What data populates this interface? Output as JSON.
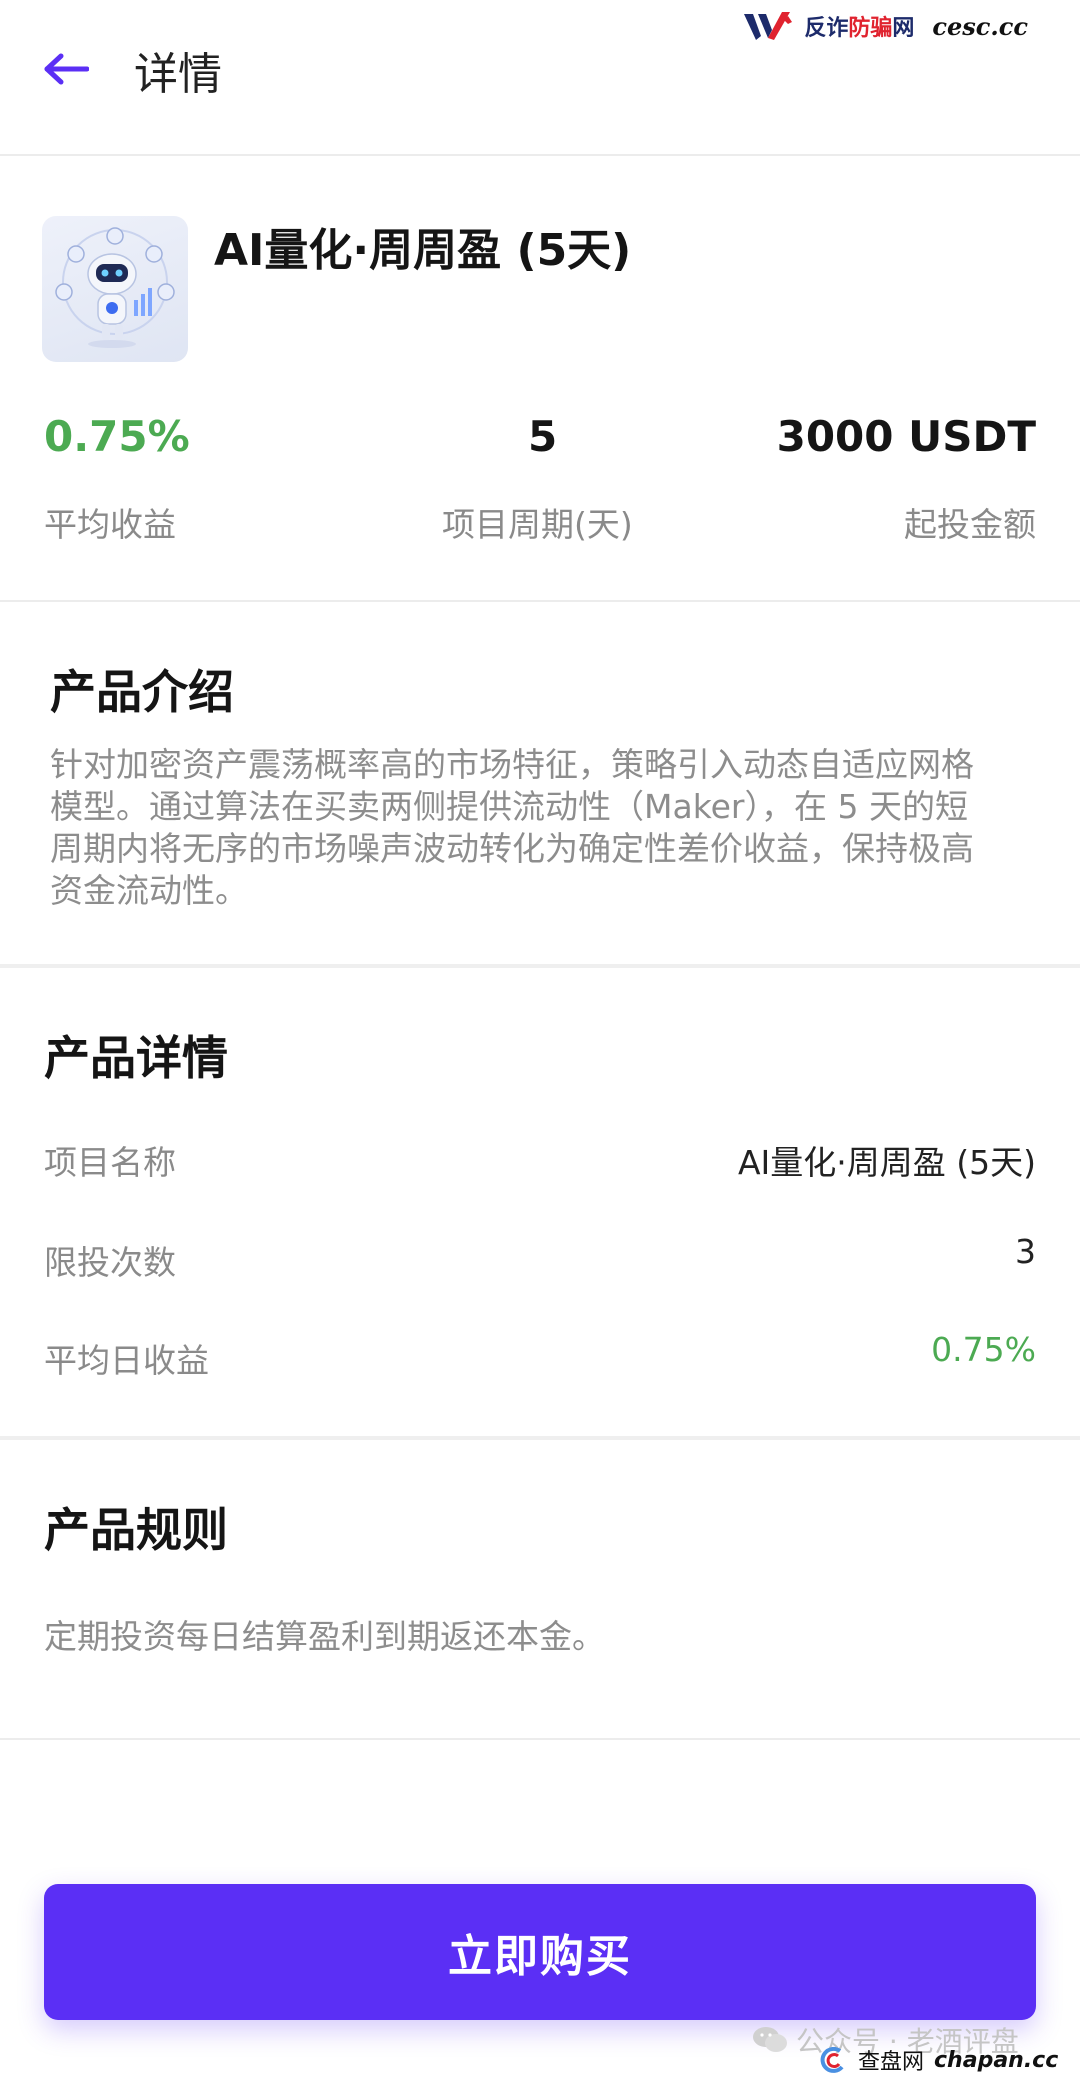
{
  "watermark_top": {
    "logo_icon": "vw-logo-icon",
    "text_a": "反诈",
    "text_red": "防骗",
    "text_b": "网",
    "site": "cesc.cc"
  },
  "header": {
    "back_icon": "arrow-left-icon",
    "title": "详情"
  },
  "product": {
    "name": "AI量化·周周盈 (5天)",
    "stats": [
      {
        "value": "0.75%",
        "label": "平均收益"
      },
      {
        "value": "5",
        "label": "项目周期(天)"
      },
      {
        "value": "3000 USDT",
        "label": "起投金额"
      }
    ]
  },
  "intro": {
    "title": "产品介绍",
    "lines": [
      "针对加密资产震荡概率高的市场特征，策略引入动态自适应网格",
      "模型。通过算法在买卖两侧提供流动性（Maker），在 5 天的短",
      "周期内将无序的市场噪声波动转化为确定性差价收益，保持极高",
      "资金流动性。"
    ]
  },
  "details": {
    "title": "产品详情",
    "rows": [
      {
        "label": "项目名称",
        "value": "AI量化·周周盈 (5天)"
      },
      {
        "label": "限投次数",
        "value": "3"
      },
      {
        "label": "平均日收益",
        "value": "0.75%"
      }
    ]
  },
  "rules": {
    "title": "产品规则",
    "text": "定期投资每日结算盈利到期返还本金。"
  },
  "buy_button": {
    "label": "立即购买"
  },
  "watermark_bottom": {
    "wechat_text": "公众号 · 老酒评盘",
    "site_label": "查盘网",
    "site": "chapan.cc"
  },
  "colors": {
    "accent": "#5b2ff5",
    "positive": "#4caa52",
    "muted": "#8a8a8a"
  }
}
